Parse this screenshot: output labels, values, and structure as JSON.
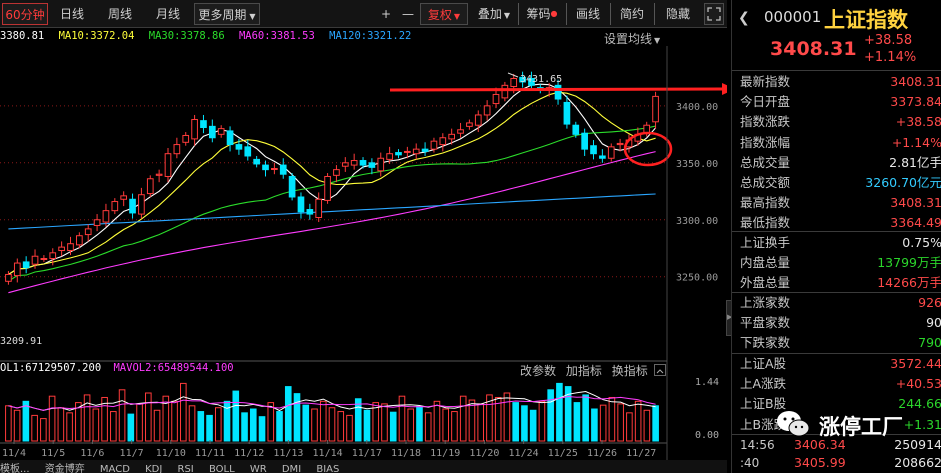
{
  "toolbar": {
    "period": "60分钟",
    "items": [
      "日线",
      "周线",
      "月线"
    ],
    "more_periods": "更多周期",
    "plus": "+",
    "minus": "—",
    "fuquan": "复权",
    "overlay": "叠加",
    "chips": "筹码",
    "draw": "画线",
    "simple": "简约",
    "hide": "隐藏"
  },
  "ma_line": {
    "ma5": "3380.81",
    "ma10": "MA10:3372.04",
    "ma30": "MA30:3378.86",
    "ma60": "MA60:3381.53",
    "ma120": "MA120:3321.22",
    "setting": "设置均线"
  },
  "colors": {
    "up": "#ff3b3b",
    "down": "#00e5ff",
    "ma5": "#ffffff",
    "ma10": "#ffff3a",
    "ma30": "#2bdc2b",
    "ma60": "#ff3cff",
    "ma120": "#2aa6ff"
  },
  "chart_data": {
    "type": "candlestick",
    "y_ticks": [
      "3400.00",
      "3350.00",
      "3300.00",
      "3250.00"
    ],
    "y_ticks_values": [
      3400,
      3350,
      3300,
      3250
    ],
    "ylim": [
      3205,
      3442
    ],
    "high_marker": "3431.65",
    "low_marker": "3209.91",
    "x_labels": [
      "11/4",
      "11/5",
      "11/6",
      "11/7",
      "11/10",
      "11/11",
      "11/12",
      "11/13",
      "11/14",
      "11/17",
      "11/18",
      "11/19",
      "11/20",
      "11/24",
      "11/25",
      "11/26",
      "11/27"
    ],
    "closes": [
      3252,
      3262,
      3258,
      3268,
      3266,
      3271,
      3276,
      3279,
      3286,
      3292,
      3300,
      3308,
      3316,
      3321,
      3306,
      3322,
      3336,
      3340,
      3358,
      3366,
      3374,
      3388,
      3381,
      3372,
      3380,
      3366,
      3362,
      3356,
      3349,
      3344,
      3345,
      3340,
      3320,
      3307,
      3305,
      3318,
      3338,
      3344,
      3350,
      3352,
      3348,
      3346,
      3354,
      3358,
      3357,
      3360,
      3362,
      3360,
      3369,
      3372,
      3375,
      3379,
      3385,
      3392,
      3400,
      3410,
      3418,
      3424,
      3421,
      3418,
      3414,
      3416,
      3406,
      3384,
      3375,
      3362,
      3358,
      3354,
      3364,
      3367,
      3370,
      3375,
      3383,
      3408.31
    ]
  },
  "volume": {
    "vol1": "OL1:67129507.200",
    "vol2": "MAVOL2:65489544.100",
    "links": [
      "改参数",
      "加指标",
      "换指标"
    ],
    "ticks": [
      "1.44",
      "0.00"
    ],
    "bars": [
      0.55,
      0.48,
      0.62,
      0.4,
      0.35,
      0.7,
      0.52,
      0.44,
      0.6,
      0.72,
      0.5,
      0.68,
      0.46,
      0.8,
      0.42,
      0.58,
      0.75,
      0.48,
      0.7,
      0.62,
      0.9,
      0.55,
      0.46,
      0.4,
      0.52,
      0.62,
      0.78,
      0.44,
      0.5,
      0.38,
      0.6,
      0.46,
      0.85,
      0.74,
      0.56,
      0.5,
      0.62,
      0.52,
      0.46,
      0.4,
      0.66,
      0.48,
      0.6,
      0.58,
      0.45,
      0.7,
      0.5,
      0.54,
      0.44,
      0.62,
      0.5,
      0.46,
      0.7,
      0.64,
      0.58,
      0.72,
      0.68,
      0.75,
      0.6,
      0.55,
      0.48,
      0.62,
      0.8,
      0.9,
      0.85,
      0.6,
      0.72,
      0.5,
      0.56,
      0.68,
      0.58,
      0.44,
      0.62,
      0.48,
      0.55
    ]
  },
  "bottom_tabs": [
    "模板...",
    "资金博弈",
    "MACD",
    "KDJ",
    "RSI",
    "BOLL",
    "WR",
    "DMI",
    "BIAS"
  ],
  "panel": {
    "code": "000001",
    "name": "上证指数",
    "price": "3408.31",
    "change": "+38.58",
    "change_pct": "+1.14%",
    "rows_a": [
      {
        "label": "最新指数",
        "value": "3408.31",
        "cls": "red"
      },
      {
        "label": "今日开盘",
        "value": "3373.84",
        "cls": "red"
      },
      {
        "label": "指数涨跌",
        "value": "+38.58",
        "cls": "red"
      },
      {
        "label": "指数涨幅",
        "value": "+1.14%",
        "cls": "red"
      },
      {
        "label": "总成交量",
        "value": "2.81亿手",
        "cls": "white"
      },
      {
        "label": "总成交额",
        "value": "3260.70亿元",
        "cls": "cyan"
      },
      {
        "label": "最高指数",
        "value": "3408.31",
        "cls": "red"
      },
      {
        "label": "最低指数",
        "value": "3364.49",
        "cls": "red"
      }
    ],
    "rows_b": [
      {
        "label": "上证换手",
        "value": "0.75%",
        "cls": "white"
      },
      {
        "label": "内盘总量",
        "value": "13799万手",
        "cls": "green"
      },
      {
        "label": "外盘总量",
        "value": "14266万手",
        "cls": "red"
      }
    ],
    "rows_c": [
      {
        "label": "上涨家数",
        "value": "926",
        "cls": "red"
      },
      {
        "label": "平盘家数",
        "value": "90",
        "cls": "white"
      },
      {
        "label": "下跌家数",
        "value": "790",
        "cls": "green"
      }
    ],
    "rows_d": [
      {
        "label": "上证A股",
        "value": "3572.44",
        "cls": "red"
      },
      {
        "label": "上A涨跌",
        "value": "+40.53",
        "cls": "red"
      },
      {
        "label": "上证B股",
        "value": "244.66",
        "cls": "green"
      },
      {
        "label": "上B涨跌",
        "value": "+1.31",
        "cls": "green"
      }
    ],
    "tick_rows": [
      {
        "time": "14:56",
        "price": "3406.34",
        "vol": "250914"
      },
      {
        "time": ":40",
        "price": "3405.99",
        "vol": "208662"
      }
    ]
  },
  "watermark": "涨停工厂"
}
